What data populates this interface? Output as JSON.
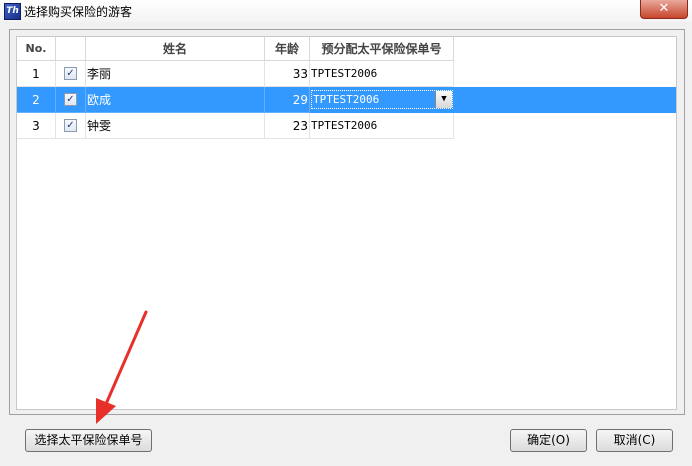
{
  "window": {
    "title": "选择购买保险的游客",
    "icon": "app-icon",
    "icon_glyph": "Th",
    "close_glyph": "✕"
  },
  "grid": {
    "columns": [
      "No.",
      "",
      "姓名",
      "年龄",
      "预分配太平保险保单号"
    ],
    "rows": [
      {
        "no": "1",
        "checked": true,
        "name": "李丽",
        "age": "33",
        "policy": "TPTEST2006",
        "selected": false
      },
      {
        "no": "2",
        "checked": true,
        "name": "欧成",
        "age": "29",
        "policy": "TPTEST2006",
        "selected": true
      },
      {
        "no": "3",
        "checked": true,
        "name": "钟雯",
        "age": "23",
        "policy": "TPTEST2006",
        "selected": false
      }
    ],
    "check_glyph": "✓",
    "dropdown_glyph": "▼"
  },
  "buttons": {
    "select_policy": "选择太平保险保单号",
    "ok": "确定(O)",
    "cancel": "取消(C)"
  },
  "colors": {
    "selection": "#3399ff",
    "annotation_arrow": "#e8302a"
  }
}
